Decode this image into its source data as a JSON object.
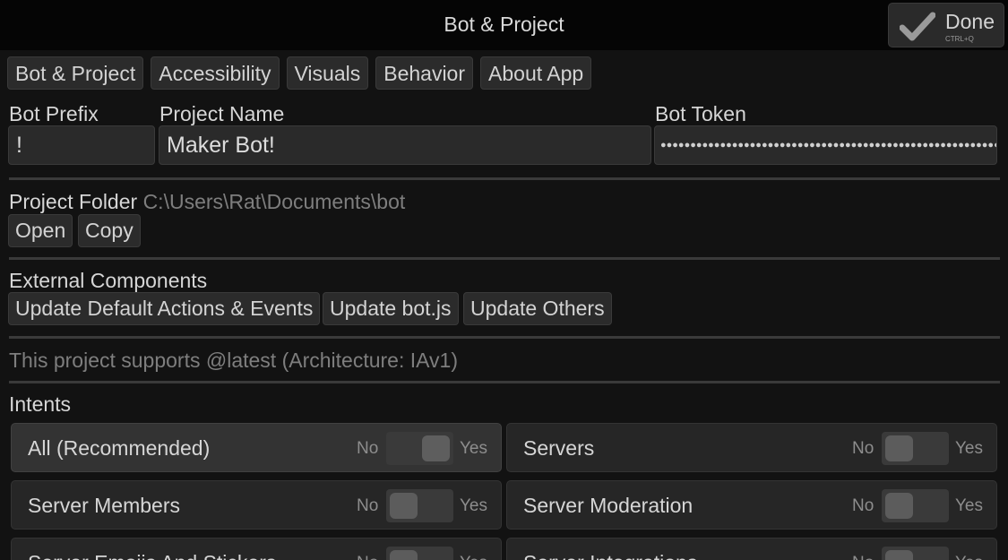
{
  "window": {
    "title": "Bot & Project",
    "done_label": "Done",
    "done_shortcut": "CTRL+Q"
  },
  "tabs": [
    {
      "label": "Bot & Project"
    },
    {
      "label": "Accessibility"
    },
    {
      "label": "Visuals"
    },
    {
      "label": "Behavior"
    },
    {
      "label": "About App"
    }
  ],
  "fields": {
    "bot_prefix": {
      "label": "Bot Prefix",
      "value": "!"
    },
    "project_name": {
      "label": "Project Name",
      "value": "Maker Bot!"
    },
    "bot_token": {
      "label": "Bot Token",
      "value": "●●●●●●●●●●●●●●●●●●●●●●●●●●●●●●●●●●●●●●●●●●●●●●●●●●●●●●●●●●●●●●●●●●●●●●●●●●●●●●●●"
    }
  },
  "project_folder": {
    "label": "Project Folder",
    "path": "C:\\Users\\Rat\\Documents\\bot",
    "open_label": "Open",
    "copy_label": "Copy"
  },
  "external_components": {
    "label": "External Components",
    "buttons": [
      {
        "label": "Update Default Actions & Events"
      },
      {
        "label": "Update bot.js"
      },
      {
        "label": "Update Others"
      }
    ]
  },
  "support_note": "This project supports @latest (Architecture: IAv1)",
  "intents": {
    "label": "Intents",
    "no_label": "No",
    "yes_label": "Yes",
    "items": [
      {
        "name": "All (Recommended)",
        "enabled": true
      },
      {
        "name": "Servers",
        "enabled": false
      },
      {
        "name": "Server Members",
        "enabled": false
      },
      {
        "name": "Server Moderation",
        "enabled": false
      },
      {
        "name": "Server Emojis And Stickers",
        "enabled": false
      },
      {
        "name": "Server Integrations",
        "enabled": false
      }
    ]
  }
}
